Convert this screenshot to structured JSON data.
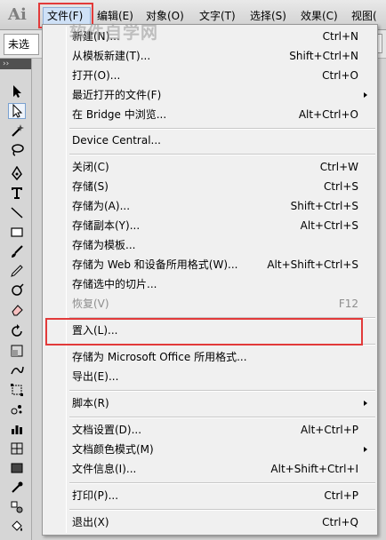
{
  "menubar": {
    "logo": "Ai",
    "items": [
      "文件(F)",
      "编辑(E)",
      "对象(O)",
      "文字(T)",
      "选择(S)",
      "效果(C)",
      "视图("
    ]
  },
  "control_strip": {
    "selection_status": "未选"
  },
  "toolbox": {
    "collapse_glyph": "››"
  },
  "watermark": "软件自学网",
  "file_menu": {
    "items": [
      {
        "label": "新建(N)...",
        "shortcut": "Ctrl+N"
      },
      {
        "label": "从模板新建(T)...",
        "shortcut": "Shift+Ctrl+N"
      },
      {
        "label": "打开(O)...",
        "shortcut": "Ctrl+O"
      },
      {
        "label": "最近打开的文件(F)",
        "shortcut": "",
        "submenu": true
      },
      {
        "label": "在 Bridge 中浏览...",
        "shortcut": "Alt+Ctrl+O"
      },
      {
        "label": "Device Central...",
        "shortcut": ""
      },
      {
        "label": "关闭(C)",
        "shortcut": "Ctrl+W"
      },
      {
        "label": "存储(S)",
        "shortcut": "Ctrl+S"
      },
      {
        "label": "存储为(A)...",
        "shortcut": "Shift+Ctrl+S"
      },
      {
        "label": "存储副本(Y)...",
        "shortcut": "Alt+Ctrl+S"
      },
      {
        "label": "存储为模板...",
        "shortcut": ""
      },
      {
        "label": "存储为 Web 和设备所用格式(W)...",
        "shortcut": "Alt+Shift+Ctrl+S"
      },
      {
        "label": "存储选中的切片...",
        "shortcut": ""
      },
      {
        "label": "恢复(V)",
        "shortcut": "F12",
        "disabled": true
      },
      {
        "label": "置入(L)...",
        "shortcut": ""
      },
      {
        "label": "存储为 Microsoft Office 所用格式...",
        "shortcut": ""
      },
      {
        "label": "导出(E)...",
        "shortcut": ""
      },
      {
        "label": "脚本(R)",
        "shortcut": "",
        "submenu": true
      },
      {
        "label": "文档设置(D)...",
        "shortcut": "Alt+Ctrl+P"
      },
      {
        "label": "文档颜色模式(M)",
        "shortcut": "",
        "submenu": true
      },
      {
        "label": "文件信息(I)...",
        "shortcut": "Alt+Shift+Ctrl+I"
      },
      {
        "label": "打印(P)...",
        "shortcut": "Ctrl+P"
      },
      {
        "label": "退出(X)",
        "shortcut": "Ctrl+Q"
      }
    ]
  },
  "colors": {
    "highlight_border": "#e23a3a",
    "menu_bg": "#f0f0f0",
    "disabled_text": "#8d8d8d"
  }
}
